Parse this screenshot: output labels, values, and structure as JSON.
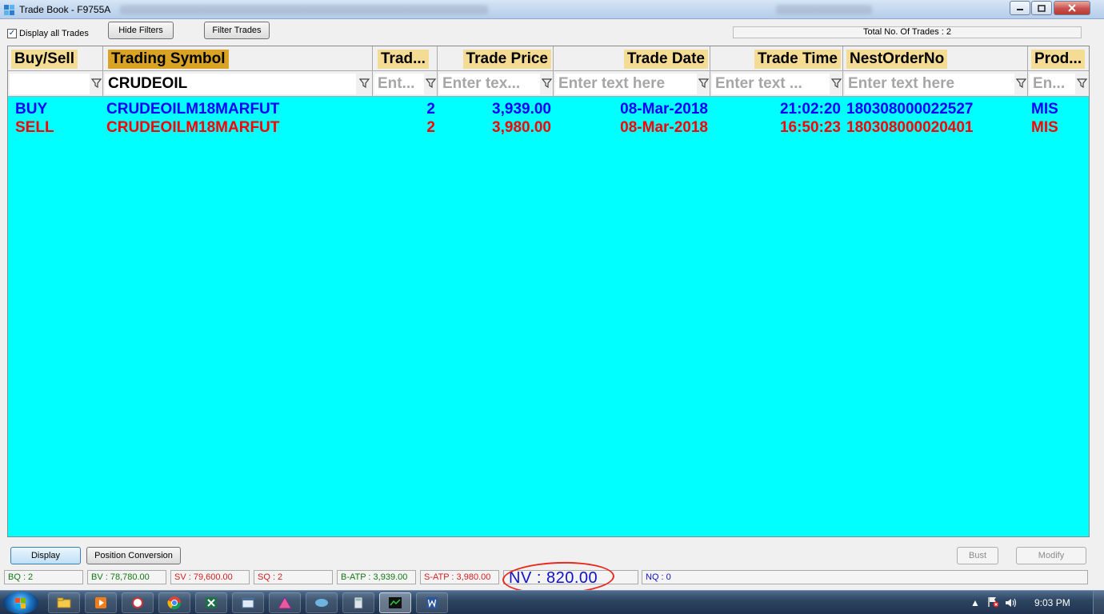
{
  "window": {
    "title": "Trade Book - F9755A",
    "minimize_icon": "minimize-icon",
    "maximize_icon": "maximize-icon",
    "close_icon": "close-icon"
  },
  "toolbar": {
    "display_all_trades_label": "Display all Trades",
    "display_all_trades_checked": true,
    "hide_filters_label": "Hide Filters",
    "filter_trades_label": "Filter Trades",
    "total_trades_text": "Total No. Of Trades : 2"
  },
  "grid": {
    "background_color": "#00ffff",
    "columns": [
      {
        "key": "buy_sell",
        "label": "Buy/Sell"
      },
      {
        "key": "trading_symbol",
        "label": "Trading Symbol"
      },
      {
        "key": "trade_qty",
        "label": "Trad..."
      },
      {
        "key": "trade_price",
        "label": "Trade Price"
      },
      {
        "key": "trade_date",
        "label": "Trade Date"
      },
      {
        "key": "trade_time",
        "label": "Trade Time"
      },
      {
        "key": "nest_order_no",
        "label": "NestOrderNo"
      },
      {
        "key": "product",
        "label": "Prod..."
      }
    ],
    "filters": {
      "buy_sell": {
        "value": "",
        "placeholder": ""
      },
      "trading_symbol": {
        "value": "CRUDEOIL",
        "placeholder": ""
      },
      "trade_qty": {
        "value": "",
        "placeholder": "Ent..."
      },
      "trade_price": {
        "value": "",
        "placeholder": "Enter tex..."
      },
      "trade_date": {
        "value": "",
        "placeholder": "Enter text here"
      },
      "trade_time": {
        "value": "",
        "placeholder": "Enter text ..."
      },
      "nest_order_no": {
        "value": "",
        "placeholder": "Enter text here"
      },
      "product": {
        "value": "",
        "placeholder": "En..."
      }
    },
    "filter_icon": "filter-funnel-icon",
    "rows": [
      {
        "buy_sell": "BUY",
        "trading_symbol": "CRUDEOILM18MARFUT",
        "trade_qty": "2",
        "trade_price": "3,939.00",
        "trade_date": "08-Mar-2018",
        "trade_time": "21:02:20",
        "nest_order_no": "180308000022527",
        "product": "MIS",
        "color": "#0000ff"
      },
      {
        "buy_sell": "SELL",
        "trading_symbol": "CRUDEOILM18MARFUT",
        "trade_qty": "2",
        "trade_price": "3,980.00",
        "trade_date": "08-Mar-2018",
        "trade_time": "16:50:23",
        "nest_order_no": "180308000020401",
        "product": "MIS",
        "color": "#ff0000"
      }
    ]
  },
  "actions": {
    "display_label": "Display",
    "position_conversion_label": "Position Conversion",
    "bust_label": "Bust",
    "modify_label": "Modify"
  },
  "status": {
    "bq": "BQ : 2",
    "bv": "BV : 78,780.00",
    "sv": "SV : 79,600.00",
    "sq": "SQ : 2",
    "batp": "B-ATP : 3,939.00",
    "satp": "S-ATP : 3,980.00",
    "nv": "NV : 820.00",
    "nq": "NQ : 0"
  },
  "taskbar": {
    "clock": "9:03 PM",
    "items": [
      "file-explorer-icon",
      "media-player-icon",
      "app-icon",
      "chrome-icon",
      "excel-icon",
      "app-window-icon",
      "app-icon",
      "app-icon",
      "calculator-icon",
      "trading-terminal-icon",
      "word-icon"
    ]
  }
}
